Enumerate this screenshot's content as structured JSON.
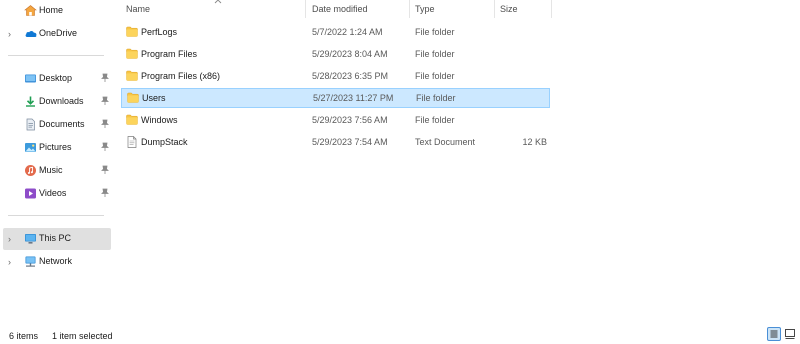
{
  "sidebar": {
    "home": {
      "label": "Home",
      "icon": "home-icon"
    },
    "onedrive": {
      "label": "OneDrive",
      "icon": "cloud-icon"
    },
    "quick_access": [
      {
        "label": "Desktop",
        "icon": "desktop-icon",
        "pinned": true
      },
      {
        "label": "Downloads",
        "icon": "download-icon",
        "pinned": true
      },
      {
        "label": "Documents",
        "icon": "documents-icon",
        "pinned": true
      },
      {
        "label": "Pictures",
        "icon": "pictures-icon",
        "pinned": true
      },
      {
        "label": "Music",
        "icon": "music-icon",
        "pinned": true
      },
      {
        "label": "Videos",
        "icon": "videos-icon",
        "pinned": true
      }
    ],
    "this_pc": {
      "label": "This PC",
      "icon": "computer-icon",
      "selected": true
    },
    "network": {
      "label": "Network",
      "icon": "network-icon"
    }
  },
  "columns": {
    "name": "Name",
    "date": "Date modified",
    "type": "Type",
    "size": "Size"
  },
  "files": [
    {
      "name": "PerfLogs",
      "date": "5/7/2022 1:24 AM",
      "type": "File folder",
      "size": "",
      "icon": "folder-icon"
    },
    {
      "name": "Program Files",
      "date": "5/29/2023 8:04 AM",
      "type": "File folder",
      "size": "",
      "icon": "folder-icon"
    },
    {
      "name": "Program Files (x86)",
      "date": "5/28/2023 6:35 PM",
      "type": "File folder",
      "size": "",
      "icon": "folder-icon"
    },
    {
      "name": "Users",
      "date": "5/27/2023 11:27 PM",
      "type": "File folder",
      "size": "",
      "icon": "folder-icon",
      "selected": true
    },
    {
      "name": "Windows",
      "date": "5/29/2023 7:56 AM",
      "type": "File folder",
      "size": "",
      "icon": "folder-icon"
    },
    {
      "name": "DumpStack",
      "date": "5/29/2023 7:54 AM",
      "type": "Text Document",
      "size": "12 KB",
      "icon": "text-file-icon"
    }
  ],
  "status": {
    "items": "6 items",
    "selected": "1 item selected"
  },
  "colors": {
    "selection": "#cce8ff",
    "selection_border": "#99d1ff",
    "folder": "#f8c543",
    "sidebar_selected": "#e0e0e0",
    "accent": "#0067c0"
  }
}
